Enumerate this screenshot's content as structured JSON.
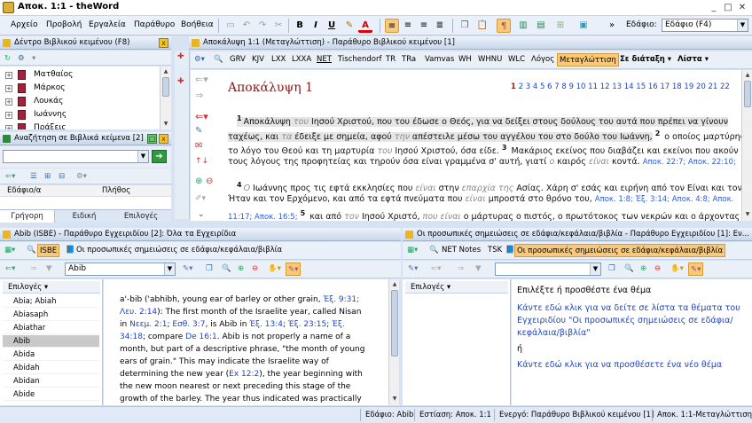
{
  "window": {
    "title": "Αποκ. 1:1 - theWord",
    "minimize": "_",
    "maximize": "□",
    "close": "✕"
  },
  "menu": [
    "Αρχείο",
    "Προβολή",
    "Εργαλεία",
    "Παράθυρο",
    "Βοήθεια"
  ],
  "toolbar": {
    "edafio_label": "Εδάφιο:",
    "edafio_value": "Εδάφιο (F4)",
    "bold": "B",
    "italic": "I",
    "underline": "U",
    "fontcolor": "A"
  },
  "left_top": {
    "header": "Δέντρο Βιβλικού κειμένου (F8)",
    "books": [
      "Ματθαίος",
      "Μάρκος",
      "Λουκάς",
      "Ιωάννης",
      "Πράξεις"
    ]
  },
  "search": {
    "header": "Αναζήτηση σε Βιβλικά κείμενα [2]",
    "col_verse": "Εδάφιο/α",
    "col_count": "Πλήθος",
    "tabs": [
      "Γρήγορη",
      "Ειδική",
      "Επιλογές"
    ]
  },
  "bible": {
    "header": "Αποκάλυψη 1:1 (Μεταγλώττιση) - Παράθυρο Βιβλικού κειμένου [1]",
    "versions": [
      "GRV",
      "KJV",
      "LXX",
      "LXXA",
      "NET",
      "Tischendorf",
      "TR",
      "TRa",
      "Vamvas",
      "WH",
      "WHNU",
      "WLC",
      "Λόγος",
      "Μεταγλώττιση"
    ],
    "parallel": "Σε διάταξη",
    "list": "Λίστα",
    "chapter_title": "Αποκάλυψη 1",
    "chapters": [
      "1",
      "2",
      "3",
      "4",
      "5",
      "6",
      "7",
      "8",
      "9",
      "10",
      "11",
      "12",
      "13",
      "14",
      "15",
      "16",
      "17",
      "18",
      "19",
      "20",
      "21",
      "22"
    ],
    "v1n": "1",
    "v1a": "Αποκάλυψη ",
    "v1b": "του",
    "v1c": " Ιησού Χριστού, που του έδωσε ο Θεός, για να δείξει στους δούλους του αυτά που πρέπει να γίνουν",
    "v1d": "ταχέως, και ",
    "v1e": "τα",
    "v1f": " έδειξε με σημεία, αφού ",
    "v1g": "την",
    "v1h": " απέστειλε μέσω του αγγέλου του στο δούλο του Ιωάννη,",
    "v2n": "2",
    "v2a": " ο οποίος μαρτύρησε",
    "v2b": "το λόγο του Θεού και τη μαρτυρία ",
    "v2c": "του",
    "v2d": " Ιησού Χριστού, όσα είδε.",
    "v3n": "3",
    "v3a": " Μακάριος εκείνος που διαβάζει και εκείνοι που ακούν",
    "v3b": "τους λόγους της προφητείας και τηρούν όσα είναι γραμμένα σ' αυτή, γιατί ",
    "v3c": "ο",
    "v3d": " καιρός ",
    "v3e": "είναι",
    "v3f": " κοντά. ",
    "v3x": "Αποκ. 22:7; Αποκ. 22:10;",
    "v4n": "4",
    "v4a": "Ο",
    "v4b": " Ιωάννης προς τις εφτά εκκλησίες που ",
    "v4c": "είναι",
    "v4d": " στην ",
    "v4e": "επαρχία της",
    "v4f": " Ασίας. Χάρη σ' εσάς και ειρήνη από τον Είναι και τον",
    "v4g": "Ήταν και τον Ερχόμενο, και από τα εφτά πνεύματα που ",
    "v4h": "είναι",
    "v4i": " μπροστά στο θρόνο του, ",
    "v4x1": "Αποκ. 1:8; Έξ. 3:14; Αποκ. 4:8; Αποκ.",
    "v4x2": "11:17; Αποκ. 16:5;",
    "v5n": "5",
    "v5a": " και από ",
    "v5b": "τον",
    "v5c": " Ιησού Χριστό, ",
    "v5d": "που είναι",
    "v5e": " ο μάρτυρας ο πιστός, ο πρωτότοκος των νεκρών και ο άρχοντας"
  },
  "dict": {
    "header": "Abib (ISBE) - Παράθυρο Εγχειριδίου [2]: Όλα τα Εγχειρίδια",
    "module": "ISBE",
    "topic_combo": "Οι προσωπικές σημειώσεις σε εδάφια/κεφάλαια/βιβλία",
    "search_value": "Abib",
    "options_label": "Επιλογές",
    "entries": [
      "Abia; Abiah",
      "Abiasaph",
      "Abiathar",
      "Abib",
      "Abida",
      "Abidah",
      "Abidan",
      "Abide"
    ],
    "t1": "a'-bib ('abhibh, young ear of barley or other grain, ",
    "x1": "Έξ. 9:31;",
    "x2": "Λευ. 2:14",
    "t2": "): The first month of the Israelite year, called Nisan",
    "t3": "in ",
    "x3": "Νεεμ. 2:1",
    "t3b": "; ",
    "x4": "Εσθ. 3:7",
    "t4": ", is Abib in ",
    "x5": "Έξ. 13:4",
    "t4b": "; ",
    "x6": "Έξ. 23:15",
    "t4c": "; ",
    "x7": "Έξ.",
    "x8": "34:18",
    "t5": "; compare ",
    "x9": "De 16:1",
    "t6": ". Abib is not properly a name of a",
    "t7": "month, but part of a descriptive phrase, \"the month of young",
    "t8": "ears of grain.\" This may indicate the Israelite way of",
    "t9": "determining the new year (",
    "x10": "Ex 12:2",
    "t10": "), the year beginning with",
    "t11": "the new moon nearest or next preceding this stage of the",
    "t12": "growth of the barley. The year thus indicated was practically"
  },
  "notes": {
    "header": "Οι προσωπικές σημειώσεις σε εδάφια/κεφάλαια/βιβλία - Παράθυρο Εγχειριδίου [1]: Εν...",
    "tab1": "NET Notes",
    "tab2": "TSK",
    "tab3": "Οι προσωπικές σημειώσεις σε εδάφια/κεφάλαια/βιβλία",
    "options_label": "Επιλογές",
    "prompt": "Επιλέξτε ή προσθέστε ένα θέμα",
    "link1a": "Κάντε εδώ κλικ για να δείτε σε λίστα τα θέματα του",
    "link1b": "Εγχειριδίου \"Οι προσωπικές σημειώσεις σε εδάφια/",
    "link1c": "κεφάλαια/βιβλία\"",
    "or": "ή",
    "link2": "Κάντε εδώ κλικ για να προσθέσετε ένα νέο θέμα"
  },
  "status": {
    "verse": "Εδάφιο: Abib",
    "focus": "Εστίαση: Αποκ. 1:1",
    "active": "Ενεργό: Παράθυρο Βιβλικού κειμένου [1]",
    "ref": "Αποκ. 1:1-Μεταγλώττιση"
  },
  "colors": {
    "accent": "#f8c97a",
    "link": "#1d46c8",
    "book": "#a0233a"
  },
  "icons": [
    "app-icon",
    "new-icon",
    "back-arrow-icon",
    "forward-arrow-icon",
    "cut-icon",
    "copy-icon",
    "paste-icon",
    "align-left-icon",
    "align-center-icon",
    "align-right-icon",
    "justify-icon",
    "zoom-in-icon",
    "zoom-out-icon",
    "search-icon",
    "bookmark-icon"
  ]
}
